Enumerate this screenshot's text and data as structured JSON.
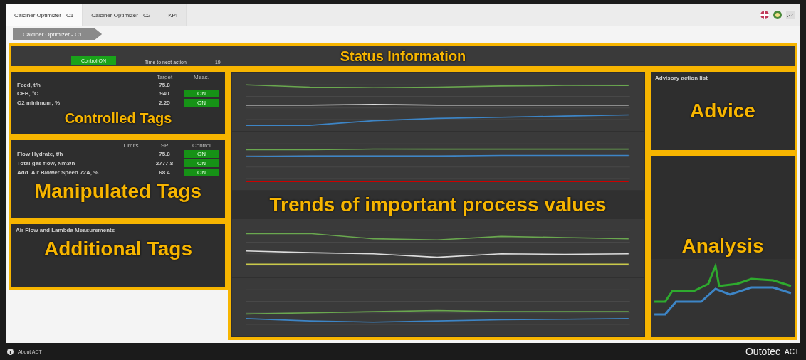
{
  "tabs": [
    {
      "label": "Calciner Optimizer - C1",
      "selected": true
    },
    {
      "label": "Calciner Optimizer - C2",
      "selected": false
    },
    {
      "label": "KPI",
      "selected": false
    }
  ],
  "breadcrumb": "Calciner Optimizer - C1",
  "status": {
    "annotation": "Status Information",
    "control_button": "Control ON",
    "next_action_label": "Time to next action",
    "next_action_value": "19"
  },
  "controlled": {
    "annotation": "Controlled Tags",
    "headers": [
      "Target",
      "Meas."
    ],
    "rows": [
      {
        "name": "Feed, t/h",
        "value": "75.8",
        "control": null
      },
      {
        "name": "CFB, °C",
        "value": "940",
        "control": "ON"
      },
      {
        "name": "O2 minimum, %",
        "value": "2.25",
        "control": "ON"
      }
    ]
  },
  "manipulated": {
    "annotation": "Manipulated Tags",
    "headers": [
      "Limits",
      "SP",
      "Control"
    ],
    "rows": [
      {
        "name": "Flow Hydrate, t/h",
        "value": "75.8",
        "control": "ON"
      },
      {
        "name": "Total gas flow, Nm3/h",
        "value": "2777.8",
        "control": "ON"
      },
      {
        "name": "Add. Air Blower Speed 72A, %",
        "value": "68.4",
        "control": "ON"
      }
    ]
  },
  "additional": {
    "annotation": "Additional Tags",
    "title": "Air Flow and Lambda Measurements"
  },
  "trends": {
    "annotation": "Trends of important process values"
  },
  "advice": {
    "annotation": "Advice",
    "title": "Advisory action list"
  },
  "analysis": {
    "annotation": "Analysis"
  },
  "footer": {
    "about": "About ACT",
    "brand": "Outotec",
    "product": "ACT"
  }
}
